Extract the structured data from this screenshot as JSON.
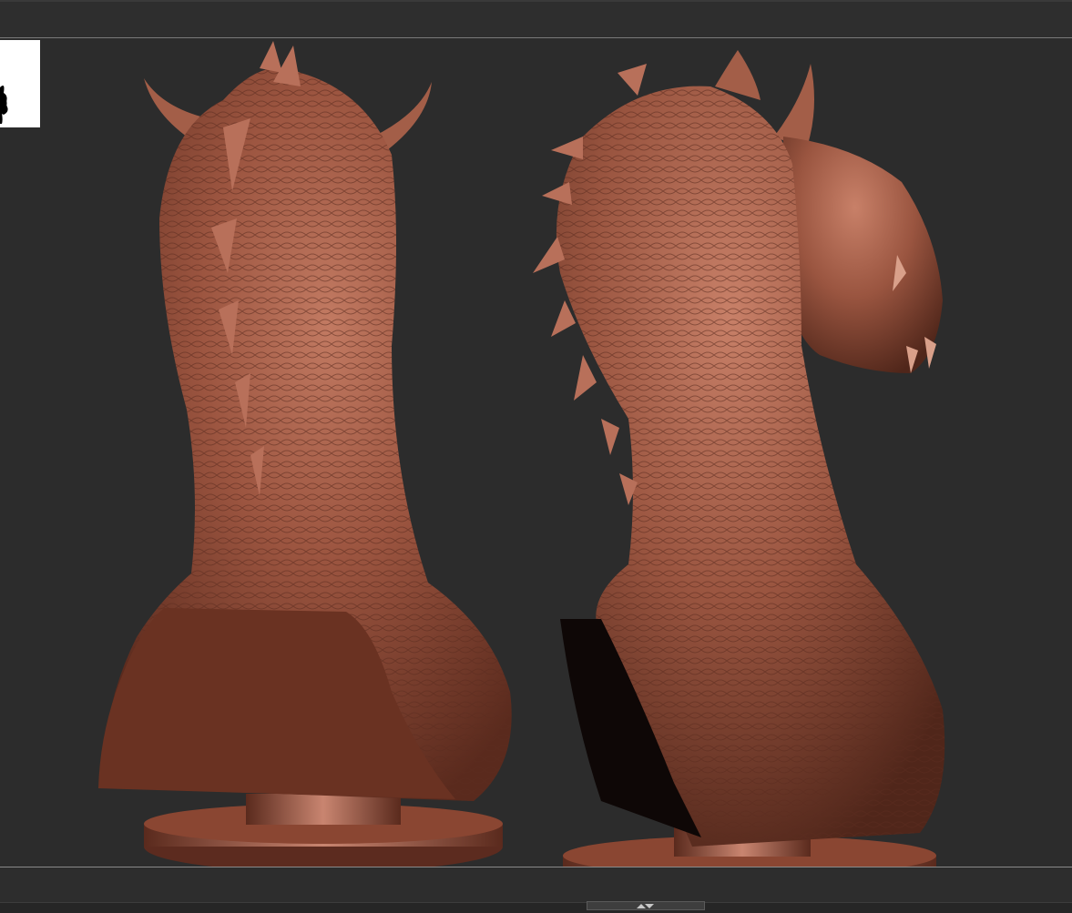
{
  "viewport": {
    "background": "#2c2c2c",
    "model_color": "#8a4a38",
    "models": [
      "dragon-bust-back-view",
      "dragon-bust-three-quarter-view"
    ]
  },
  "icons": {
    "thumbnail": "scorpion-icon",
    "bottom_handle": "collapse-arrows-icon"
  }
}
